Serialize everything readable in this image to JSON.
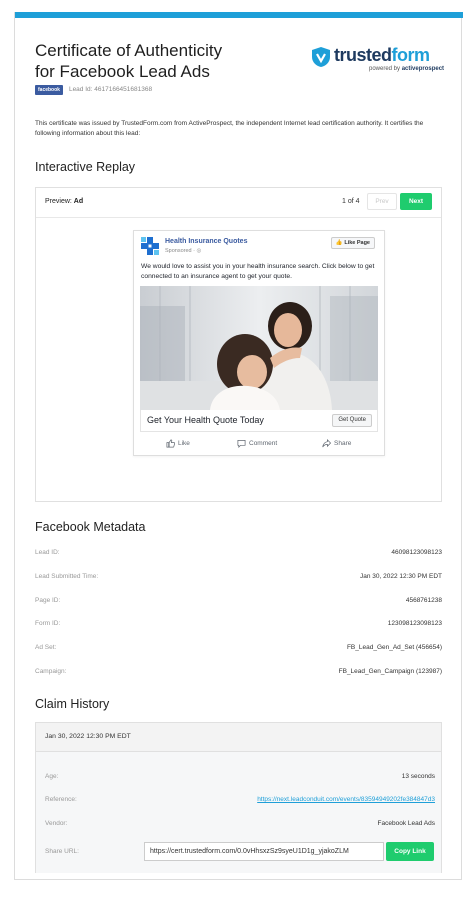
{
  "header": {
    "title_line1": "Certificate of Authenticity",
    "title_line2": "for Facebook Lead Ads",
    "badge": "facebook",
    "lead_id": "Lead Id: 4617166451681368",
    "logo": {
      "brand_a": "trusted",
      "brand_b": "form",
      "powered_prefix": "powered by ",
      "powered_brand": "activeprospect"
    },
    "intro": "This certificate was issued by TrustedForm.com from ActiveProspect, the independent Internet lead certification authority. It certifies the following information about this lead:"
  },
  "replay": {
    "section_title": "Interactive Replay",
    "preview_label": "Preview:",
    "preview_value": "Ad",
    "pager": "1 of 4",
    "prev_label": "Prev",
    "next_label": "Next",
    "ad": {
      "page_name": "Health Insurance Quotes",
      "sponsored": "Sponsored · ◎",
      "like_page": "Like Page",
      "body": "We would love to assist you in your health insurance search. Click below to get connected to an insurance agent to get your quote.",
      "cta_title": "Get Your Health Quote Today",
      "cta_button": "Get Quote",
      "actions": {
        "like": "Like",
        "comment": "Comment",
        "share": "Share"
      }
    }
  },
  "metadata": {
    "section_title": "Facebook Metadata",
    "rows": [
      {
        "k": "Lead ID:",
        "v": "46098123098123"
      },
      {
        "k": "Lead Submitted Time:",
        "v": "Jan 30, 2022 12:30 PM EDT"
      },
      {
        "k": "Page ID:",
        "v": "4568761238"
      },
      {
        "k": "Form ID:",
        "v": "123098123098123"
      },
      {
        "k": "Ad Set:",
        "v": "FB_Lead_Gen_Ad_Set (456654)"
      },
      {
        "k": "Campaign:",
        "v": "FB_Lead_Gen_Campaign (123987)"
      }
    ]
  },
  "claims": {
    "section_title": "Claim History",
    "date": "Jan 30, 2022 12:30 PM EDT",
    "age_label": "Age:",
    "age": "13 seconds",
    "reference_label": "Reference:",
    "reference": "https://next.leadconduit.com/events/83594949202fe384847d3",
    "vendor_label": "Vendor:",
    "vendor": "Facebook Lead Ads",
    "share_label": "Share URL:",
    "share_url": "https://cert.trustedform.com/0.0vHhsxzSz9syeU1D1g_yjakoZLM",
    "copy_label": "Copy Link"
  },
  "colors": {
    "accent": "#1e9fd8",
    "green": "#1fcc6e",
    "facebook": "#3b5ba0"
  }
}
